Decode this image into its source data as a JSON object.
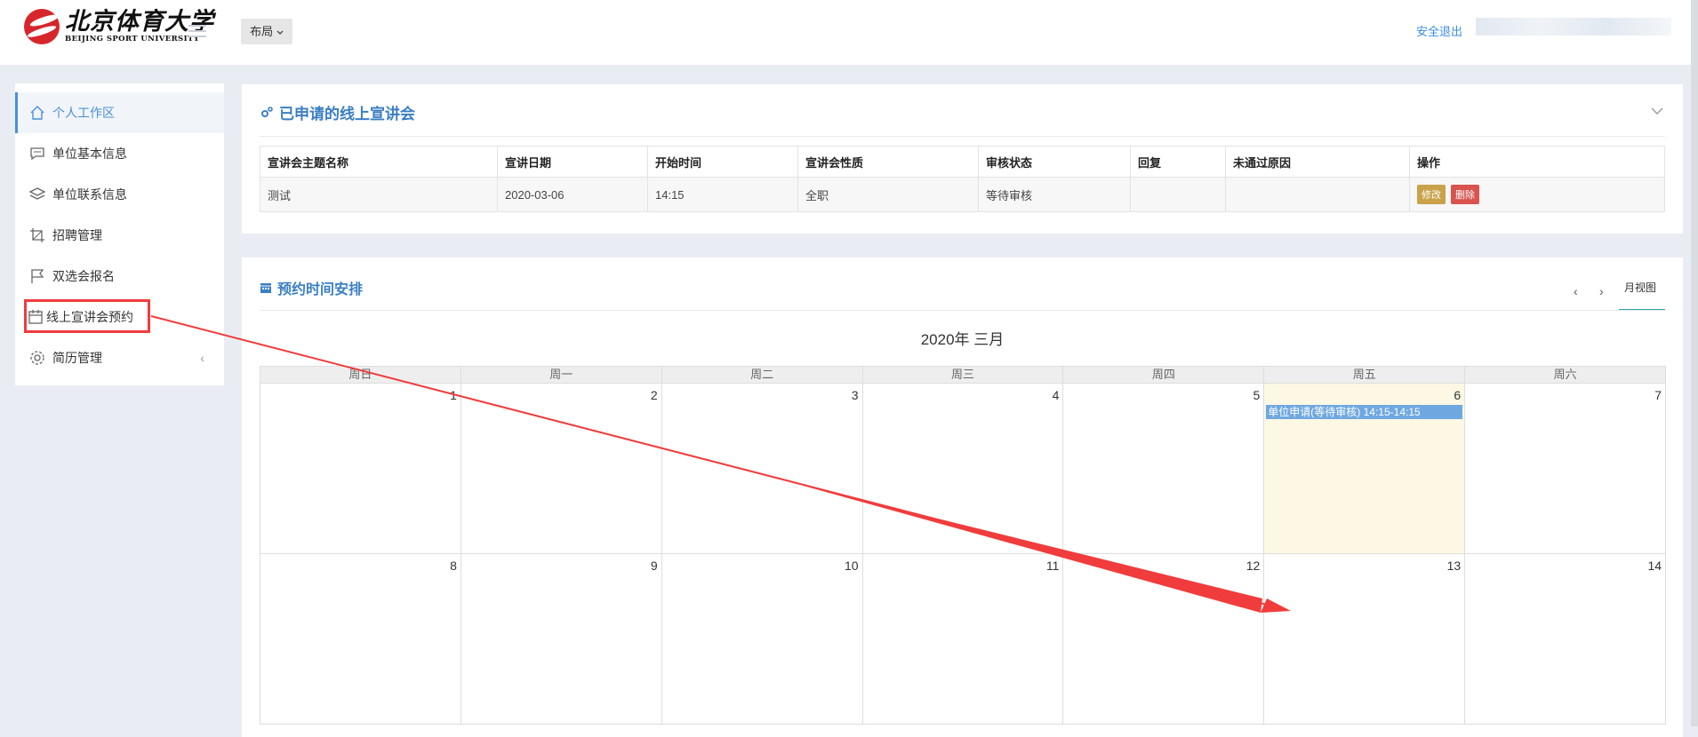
{
  "header": {
    "logo_cn": "北京体育大学",
    "logo_en": "BEIJING SPORT UNIVERSITY",
    "layout_label": "布局",
    "logout_label": "安全退出"
  },
  "sidebar": {
    "items": [
      {
        "label": "个人工作区",
        "icon": "home-icon",
        "active": true
      },
      {
        "label": "单位基本信息",
        "icon": "message-icon"
      },
      {
        "label": "单位联系信息",
        "icon": "layers-icon"
      },
      {
        "label": "招聘管理",
        "icon": "crop-icon"
      },
      {
        "label": "双选会报名",
        "icon": "flag-icon"
      },
      {
        "label": "线上宣讲会预约",
        "icon": "calendar-icon"
      },
      {
        "label": "简历管理",
        "icon": "gear-icon"
      }
    ]
  },
  "applied": {
    "title": "已申请的线上宣讲会",
    "columns": [
      "宣讲会主题名称",
      "宣讲日期",
      "开始时间",
      "宣讲会性质",
      "审核状态",
      "回复",
      "未通过原因",
      "操作"
    ],
    "rows": [
      {
        "name": "测试",
        "date": "2020-03-06",
        "start": "14:15",
        "nature": "全职",
        "status": "等待审核",
        "reply": "",
        "reason": "",
        "edit": "修改",
        "del": "删除"
      }
    ]
  },
  "schedule": {
    "title": "预约时间安排",
    "prev": "‹",
    "next": "›",
    "view_label": "月视图",
    "month_title": "2020年 三月",
    "weekdays": [
      "周日",
      "周一",
      "周二",
      "周三",
      "周四",
      "周五",
      "周六"
    ],
    "weeks": [
      [
        "1",
        "2",
        "3",
        "4",
        "5",
        "6",
        "7"
      ],
      [
        "8",
        "9",
        "10",
        "11",
        "12",
        "13",
        "14"
      ]
    ],
    "event": {
      "text": "单位申请(等待审核) 14:15-14:15",
      "day": "6"
    }
  },
  "colors": {
    "accent": "#3a7fc4",
    "highlight": "#f03c3c",
    "event": "#6fa8e0",
    "today": "#fcf8e3"
  }
}
